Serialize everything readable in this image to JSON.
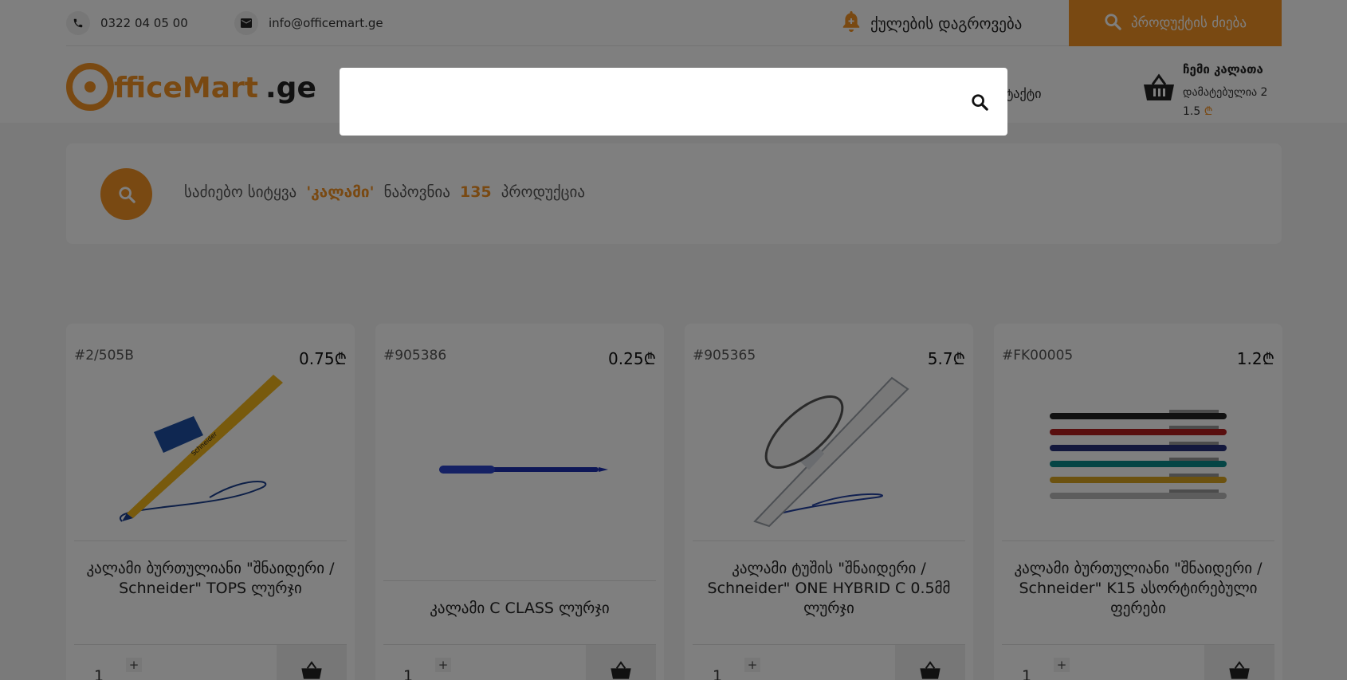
{
  "topbar": {
    "phone": "0322 04 05 00",
    "email": "info@officemart.ge",
    "wishlist_label": "ქულების დაგროვება",
    "search_label": "პროდუქტის ძიება"
  },
  "header": {
    "logo_part1": "fficeMart",
    "logo_part2": ".ge",
    "nav_contact": "ონტაქტი",
    "cart": {
      "title": "ჩემი კალათა",
      "added": "დამატებულია 2",
      "total": "1.5",
      "currency": "₾"
    }
  },
  "search_result": {
    "prefix": "საძიებო სიტყვა",
    "term": "'კალამი'",
    "middle": "ნაპოვნია",
    "count": "135",
    "suffix": "პროდუქცია"
  },
  "products": [
    {
      "sku": "#2/505B",
      "price": "0.75₾",
      "name": "კალამი ბურთულიანი \"შნაიდერი / Schneider\" TOPS ლურჯი",
      "qty": "1",
      "image": "yellow-pen-image"
    },
    {
      "sku": "#905386",
      "price": "0.25₾",
      "name": "კალამი C CLASS ლურჯი",
      "qty": "1",
      "image": "blue-pen-image"
    },
    {
      "sku": "#905365",
      "price": "5.7₾",
      "name": "კალამი ტუშის \"შნაიდერი / Schneider\" ONE HYBRID C 0.5მმ ლურჯი",
      "qty": "1",
      "image": "white-rollerball-image"
    },
    {
      "sku": "#FK00005",
      "price": "1.2₾",
      "name": "კალამი ბურთულიანი \"შნაიდერი / Schneider\" K15 ასორტირებული ფერები",
      "qty": "1",
      "image": "assorted-pens-image"
    }
  ],
  "search_modal": {
    "value": "",
    "placeholder": ""
  },
  "colors": {
    "accent": "#f39325",
    "overlay": "rgba(0,0,0,0.5)"
  }
}
